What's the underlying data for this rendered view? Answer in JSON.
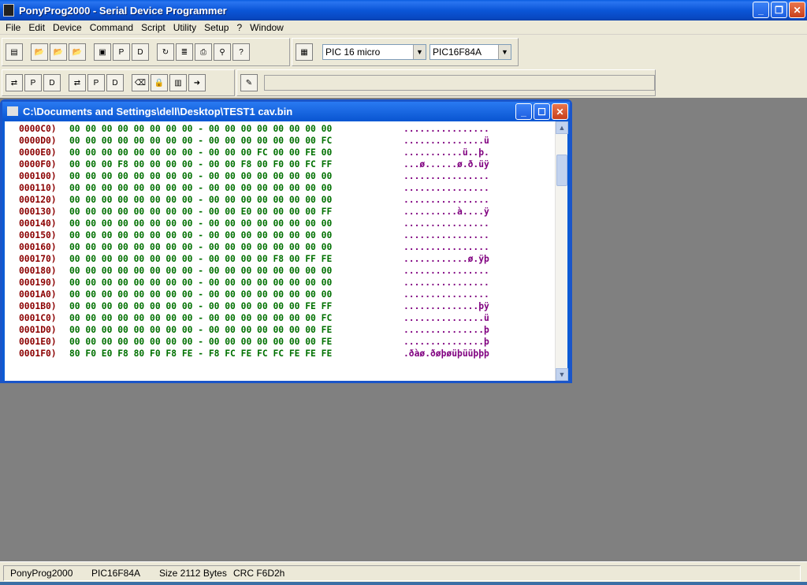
{
  "app": {
    "title": "PonyProg2000 - Serial Device Programmer"
  },
  "menu": [
    "File",
    "Edit",
    "Device",
    "Command",
    "Script",
    "Utility",
    "Setup",
    "?",
    "Window"
  ],
  "toolbar": {
    "device_family": "PIC 16 micro",
    "device_model": "PIC16F84A"
  },
  "child_window": {
    "title": "C:\\Documents and Settings\\dell\\Desktop\\TEST1 cav.bin",
    "rows": [
      {
        "addr": "0000C0)",
        "bytes": "00 00 00 00 00 00 00 00 - 00 00 00 00 00 00 00 00",
        "ascii": "................"
      },
      {
        "addr": "0000D0)",
        "bytes": "00 00 00 00 00 00 00 00 - 00 00 00 00 00 00 00 FC",
        "ascii": "...............ü"
      },
      {
        "addr": "0000E0)",
        "bytes": "00 00 00 00 00 00 00 00 - 00 00 00 FC 00 00 FE 00",
        "ascii": "...........ü..þ."
      },
      {
        "addr": "0000F0)",
        "bytes": "00 00 00 F8 00 00 00 00 - 00 00 F8 00 F0 00 FC FF",
        "ascii": "...ø......ø.ð.üÿ"
      },
      {
        "addr": "000100)",
        "bytes": "00 00 00 00 00 00 00 00 - 00 00 00 00 00 00 00 00",
        "ascii": "................"
      },
      {
        "addr": "000110)",
        "bytes": "00 00 00 00 00 00 00 00 - 00 00 00 00 00 00 00 00",
        "ascii": "................"
      },
      {
        "addr": "000120)",
        "bytes": "00 00 00 00 00 00 00 00 - 00 00 00 00 00 00 00 00",
        "ascii": "................"
      },
      {
        "addr": "000130)",
        "bytes": "00 00 00 00 00 00 00 00 - 00 00 E0 00 00 00 00 FF",
        "ascii": "..........à....ÿ"
      },
      {
        "addr": "000140)",
        "bytes": "00 00 00 00 00 00 00 00 - 00 00 00 00 00 00 00 00",
        "ascii": "................"
      },
      {
        "addr": "000150)",
        "bytes": "00 00 00 00 00 00 00 00 - 00 00 00 00 00 00 00 00",
        "ascii": "................"
      },
      {
        "addr": "000160)",
        "bytes": "00 00 00 00 00 00 00 00 - 00 00 00 00 00 00 00 00",
        "ascii": "................"
      },
      {
        "addr": "000170)",
        "bytes": "00 00 00 00 00 00 00 00 - 00 00 00 00 F8 00 FF FE",
        "ascii": "............ø.ÿþ"
      },
      {
        "addr": "000180)",
        "bytes": "00 00 00 00 00 00 00 00 - 00 00 00 00 00 00 00 00",
        "ascii": "................"
      },
      {
        "addr": "000190)",
        "bytes": "00 00 00 00 00 00 00 00 - 00 00 00 00 00 00 00 00",
        "ascii": "................"
      },
      {
        "addr": "0001A0)",
        "bytes": "00 00 00 00 00 00 00 00 - 00 00 00 00 00 00 00 00",
        "ascii": "................"
      },
      {
        "addr": "0001B0)",
        "bytes": "00 00 00 00 00 00 00 00 - 00 00 00 00 00 00 FE FF",
        "ascii": "..............þÿ"
      },
      {
        "addr": "0001C0)",
        "bytes": "00 00 00 00 00 00 00 00 - 00 00 00 00 00 00 00 FC",
        "ascii": "...............ü"
      },
      {
        "addr": "0001D0)",
        "bytes": "00 00 00 00 00 00 00 00 - 00 00 00 00 00 00 00 FE",
        "ascii": "...............þ"
      },
      {
        "addr": "0001E0)",
        "bytes": "00 00 00 00 00 00 00 00 - 00 00 00 00 00 00 00 FE",
        "ascii": "...............þ"
      },
      {
        "addr": "0001F0)",
        "bytes": "80 F0 E0 F8 80 F0 F8 FE - F8 FC FE FC FC FE FE FE",
        "ascii": ".ðàø.ðøþøüþüüþþþ"
      }
    ]
  },
  "status": {
    "app": "PonyProg2000",
    "device": "PIC16F84A",
    "size": "Size  2112 Bytes",
    "crc": "CRC  F6D2h"
  },
  "colors": {
    "address": "#8b0000",
    "hex": "#007000",
    "ascii": "#800080",
    "titlebar": "#0b56d8"
  }
}
